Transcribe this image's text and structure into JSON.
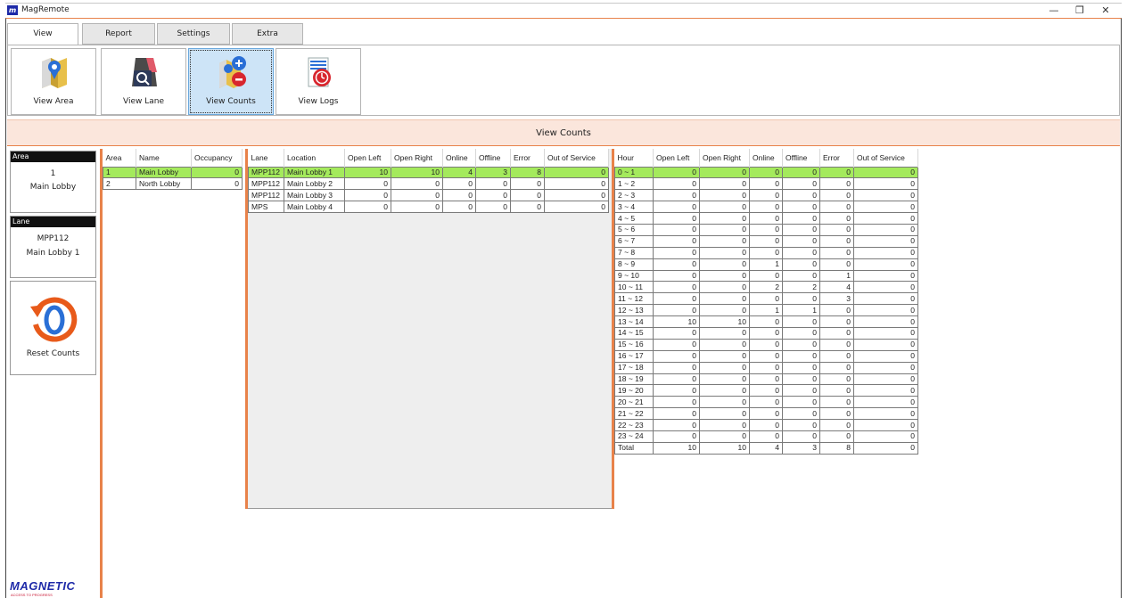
{
  "window": {
    "title": "MagRemote",
    "icon": "magremote-logo-icon",
    "min_glyph": "—",
    "max_glyph": "❐",
    "close_glyph": "✕"
  },
  "tabs": [
    {
      "label": "View",
      "active": true
    },
    {
      "label": "Report",
      "active": false
    },
    {
      "label": "Settings",
      "active": false
    },
    {
      "label": "Extra",
      "active": false
    }
  ],
  "ribbon": {
    "buttons": [
      {
        "label": "View Area",
        "icon": "map-pin-icon",
        "active": false
      },
      {
        "label": "View Lane",
        "icon": "lane-search-icon",
        "active": false
      },
      {
        "label": "View Counts",
        "icon": "counts-plus-minus-icon",
        "active": true
      },
      {
        "label": "View Logs",
        "icon": "logs-clock-icon",
        "active": false
      }
    ]
  },
  "view_header": "View Counts",
  "sidebar": {
    "area_label": "Area",
    "area_number": "1",
    "area_name": "Main Lobby",
    "lane_label": "Lane",
    "lane_id": "MPP112",
    "lane_name": "Main Lobby 1",
    "reset_label": "Reset Counts",
    "reset_icon": "reset-zero-icon"
  },
  "brand": {
    "name": "MAGNETIC",
    "tagline": "ACCESS TO PROGRESS"
  },
  "colors": {
    "accent": "#e8824a",
    "selected_row": "#a4ea5c",
    "header_bg": "#fbe6dc",
    "active_button": "#cde4f7"
  },
  "area_table": {
    "headers": [
      "Area",
      "Name",
      "Occupancy"
    ],
    "rows": [
      [
        "1",
        "Main Lobby",
        "0"
      ],
      [
        "2",
        "North Lobby",
        "0"
      ]
    ],
    "selected_row": 0
  },
  "lane_table": {
    "headers": [
      "Lane",
      "Location",
      "Open Left",
      "Open Right",
      "Online",
      "Offline",
      "Error",
      "Out of Service"
    ],
    "rows": [
      [
        "MPP112",
        "Main Lobby 1",
        "10",
        "10",
        "4",
        "3",
        "8",
        "0"
      ],
      [
        "MPP112",
        "Main Lobby 2",
        "0",
        "0",
        "0",
        "0",
        "0",
        "0"
      ],
      [
        "MPP112",
        "Main Lobby 3",
        "0",
        "0",
        "0",
        "0",
        "0",
        "0"
      ],
      [
        "MPS",
        "Main Lobby 4",
        "0",
        "0",
        "0",
        "0",
        "0",
        "0"
      ]
    ],
    "selected_row": 0
  },
  "hour_table": {
    "headers": [
      "Hour",
      "Open Left",
      "Open Right",
      "Online",
      "Offline",
      "Error",
      "Out of Service"
    ],
    "rows": [
      [
        "0 ~ 1",
        "0",
        "0",
        "0",
        "0",
        "0",
        "0"
      ],
      [
        "1 ~ 2",
        "0",
        "0",
        "0",
        "0",
        "0",
        "0"
      ],
      [
        "2 ~ 3",
        "0",
        "0",
        "0",
        "0",
        "0",
        "0"
      ],
      [
        "3 ~ 4",
        "0",
        "0",
        "0",
        "0",
        "0",
        "0"
      ],
      [
        "4 ~ 5",
        "0",
        "0",
        "0",
        "0",
        "0",
        "0"
      ],
      [
        "5 ~ 6",
        "0",
        "0",
        "0",
        "0",
        "0",
        "0"
      ],
      [
        "6 ~ 7",
        "0",
        "0",
        "0",
        "0",
        "0",
        "0"
      ],
      [
        "7 ~ 8",
        "0",
        "0",
        "0",
        "0",
        "0",
        "0"
      ],
      [
        "8 ~ 9",
        "0",
        "0",
        "1",
        "0",
        "0",
        "0"
      ],
      [
        "9 ~ 10",
        "0",
        "0",
        "0",
        "0",
        "1",
        "0"
      ],
      [
        "10 ~ 11",
        "0",
        "0",
        "2",
        "2",
        "4",
        "0"
      ],
      [
        "11 ~ 12",
        "0",
        "0",
        "0",
        "0",
        "3",
        "0"
      ],
      [
        "12 ~ 13",
        "0",
        "0",
        "1",
        "1",
        "0",
        "0"
      ],
      [
        "13 ~ 14",
        "10",
        "10",
        "0",
        "0",
        "0",
        "0"
      ],
      [
        "14 ~ 15",
        "0",
        "0",
        "0",
        "0",
        "0",
        "0"
      ],
      [
        "15 ~ 16",
        "0",
        "0",
        "0",
        "0",
        "0",
        "0"
      ],
      [
        "16 ~ 17",
        "0",
        "0",
        "0",
        "0",
        "0",
        "0"
      ],
      [
        "17 ~ 18",
        "0",
        "0",
        "0",
        "0",
        "0",
        "0"
      ],
      [
        "18 ~ 19",
        "0",
        "0",
        "0",
        "0",
        "0",
        "0"
      ],
      [
        "19 ~ 20",
        "0",
        "0",
        "0",
        "0",
        "0",
        "0"
      ],
      [
        "20 ~ 21",
        "0",
        "0",
        "0",
        "0",
        "0",
        "0"
      ],
      [
        "21 ~ 22",
        "0",
        "0",
        "0",
        "0",
        "0",
        "0"
      ],
      [
        "22 ~ 23",
        "0",
        "0",
        "0",
        "0",
        "0",
        "0"
      ],
      [
        "23 ~ 24",
        "0",
        "0",
        "0",
        "0",
        "0",
        "0"
      ],
      [
        "Total",
        "10",
        "10",
        "4",
        "3",
        "8",
        "0"
      ]
    ],
    "selected_row": 0
  }
}
